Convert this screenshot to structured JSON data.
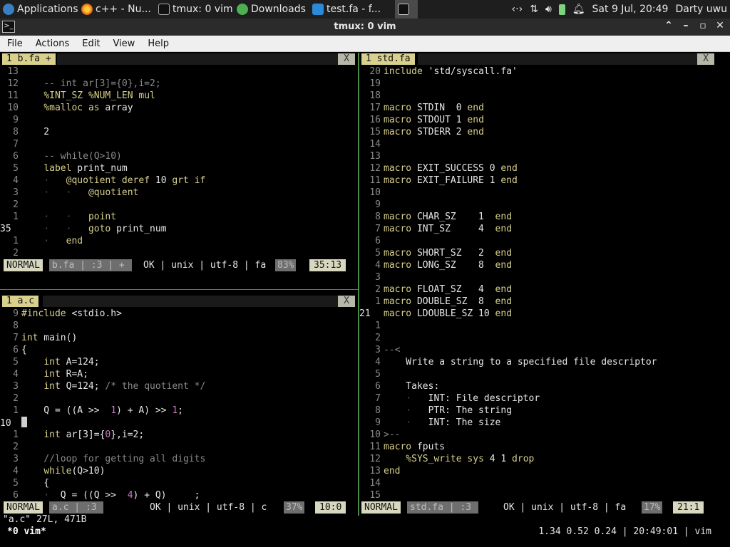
{
  "panel": {
    "tasks": [
      {
        "label": "Applications ☰"
      },
      {
        "label": "c++ - Nu..."
      },
      {
        "label": "tmux: 0 vim"
      },
      {
        "label": "Downloads"
      },
      {
        "label": "test.fa - f..."
      }
    ],
    "clock": "Sat  9 Jul, 20:49",
    "user": "Darty uwu"
  },
  "window": {
    "title": "tmux: 0 vim"
  },
  "menu": {
    "items": [
      "File",
      "Actions",
      "Edit",
      "View",
      "Help"
    ]
  },
  "panes": {
    "top_left": {
      "tab": "1 b.fa +",
      "close": "X",
      "lines": [
        [
          "13",
          ""
        ],
        [
          "12",
          "    -- int ar[3]={0},i=2;"
        ],
        [
          "11",
          "    %INT_SZ %NUM_LEN mul"
        ],
        [
          "10",
          "    %malloc as array"
        ],
        [
          "9",
          ""
        ],
        [
          "8",
          "    2"
        ],
        [
          "7",
          ""
        ],
        [
          "6",
          "    -- while(Q>10)"
        ],
        [
          "5",
          "    label print_num"
        ],
        [
          "4",
          "    ·   @quotient deref 10 grt if"
        ],
        [
          "3",
          "    ·   ·   @quotient"
        ],
        [
          "2",
          ""
        ],
        [
          "1",
          "    ·   ·   point"
        ],
        [
          "35",
          "    ·   ·   goto print_num"
        ],
        [
          "1",
          "    ·   end"
        ],
        [
          "2",
          ""
        ]
      ],
      "status": {
        "mode": "NORMAL",
        "file": "b.fa | :3 | +",
        "mid": "OK | unix | utf-8 | fa",
        "pct": "83%",
        "pos": "35:13"
      }
    },
    "bottom_left": {
      "tab": "1 a.c",
      "close": "X",
      "lines": [
        [
          "9",
          "#include <stdio.h>"
        ],
        [
          "8",
          ""
        ],
        [
          "7",
          "int main()"
        ],
        [
          "6",
          "{"
        ],
        [
          "5",
          "    int A=124;"
        ],
        [
          "4",
          "    int R=A;"
        ],
        [
          "3",
          "    int Q=124; /* the quotient */"
        ],
        [
          "2",
          ""
        ],
        [
          "1",
          "    Q = ((A >>  1) + A) >> 1;"
        ],
        [
          "10",
          ""
        ],
        [
          "1",
          "    int ar[3]={0},i=2;"
        ],
        [
          "2",
          ""
        ],
        [
          "3",
          "    //loop for getting all digits"
        ],
        [
          "4",
          "    while(Q>10)"
        ],
        [
          "5",
          "    {"
        ],
        [
          "6",
          "    ·  Q = ((Q >>  4) + Q)     ;"
        ]
      ],
      "status": {
        "mode": "NORMAL",
        "file": "a.c | :3",
        "mid": "OK | unix | utf-8 | c",
        "pct": "37%",
        "pos": "10:0"
      }
    },
    "right": {
      "tab": "1 std.fa",
      "close": "X",
      "lines": [
        [
          "20",
          "include 'std/syscall.fa'"
        ],
        [
          "19",
          ""
        ],
        [
          "18",
          ""
        ],
        [
          "17",
          "macro STDIN  0 end"
        ],
        [
          "16",
          "macro STDOUT 1 end"
        ],
        [
          "15",
          "macro STDERR 2 end"
        ],
        [
          "14",
          ""
        ],
        [
          "13",
          ""
        ],
        [
          "12",
          "macro EXIT_SUCCESS 0 end"
        ],
        [
          "11",
          "macro EXIT_FAILURE 1 end"
        ],
        [
          "10",
          ""
        ],
        [
          "9",
          ""
        ],
        [
          "8",
          "macro CHAR_SZ    1  end"
        ],
        [
          "7",
          "macro INT_SZ     4  end"
        ],
        [
          "6",
          ""
        ],
        [
          "5",
          "macro SHORT_SZ   2  end"
        ],
        [
          "4",
          "macro LONG_SZ    8  end"
        ],
        [
          "3",
          ""
        ],
        [
          "2",
          "macro FLOAT_SZ   4  end"
        ],
        [
          "1",
          "macro DOUBLE_SZ  8  end"
        ],
        [
          "21",
          "macro LDOUBLE_SZ 10 end"
        ],
        [
          "1",
          ""
        ],
        [
          "2",
          ""
        ],
        [
          "3",
          "--<"
        ],
        [
          "4",
          "    Write a string to a specified file descriptor"
        ],
        [
          "5",
          ""
        ],
        [
          "6",
          "    Takes:"
        ],
        [
          "7",
          "    ·   INT: File descriptor"
        ],
        [
          "8",
          "    ·   PTR: The string"
        ],
        [
          "9",
          "    ·   INT: The size"
        ],
        [
          "10",
          ">--"
        ],
        [
          "11",
          "macro fputs"
        ],
        [
          "12",
          "    %SYS_write sys 4 1 drop"
        ],
        [
          "13",
          "end"
        ],
        [
          "14",
          ""
        ],
        [
          "15",
          ""
        ]
      ],
      "status": {
        "mode": "NORMAL",
        "file": "std.fa | :3",
        "mid": "OK | unix | utf-8 | fa",
        "pct": "17%",
        "pos": "21:1"
      }
    }
  },
  "cmdline": "\"a.c\" 27L, 471B",
  "tmux": {
    "window": "*0 vim*",
    "right": "1.34 0.52 0.24 | 20:49:01 | vim"
  },
  "colors": {
    "accent": "#d8d08c",
    "separator": "#4a8a4a",
    "comment": "#8a8a8a",
    "number": "#c879c8"
  }
}
